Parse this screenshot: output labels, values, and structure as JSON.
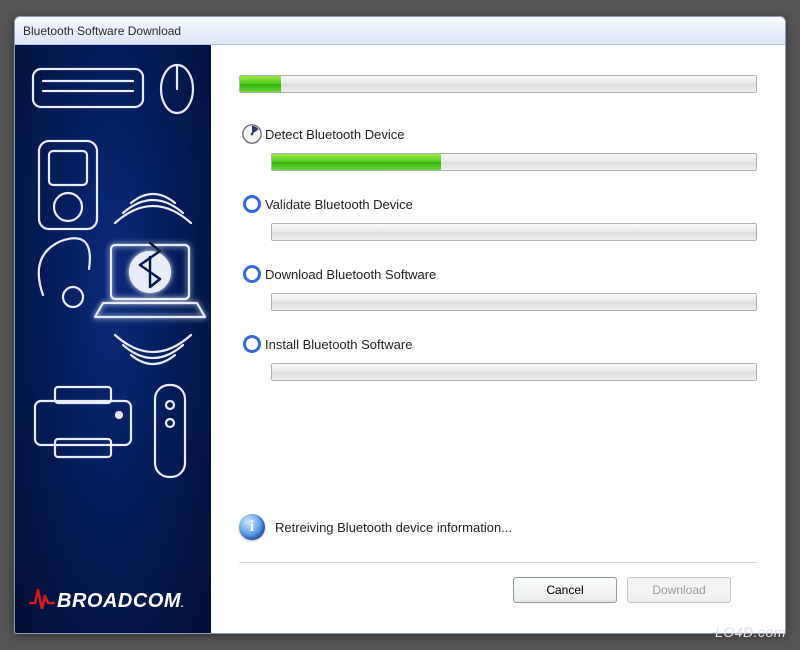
{
  "window": {
    "title": "Bluetooth Software Download"
  },
  "overall_progress_percent": 8,
  "steps": [
    {
      "label": "Detect Bluetooth Device",
      "status": "active",
      "progress": 35
    },
    {
      "label": "Validate Bluetooth Device",
      "status": "pending",
      "progress": 0
    },
    {
      "label": "Download Bluetooth Software",
      "status": "pending",
      "progress": 0
    },
    {
      "label": "Install Bluetooth Software",
      "status": "pending",
      "progress": 0
    }
  ],
  "status_message": "Retreiving Bluetooth device information...",
  "buttons": {
    "cancel": {
      "label": "Cancel",
      "enabled": true
    },
    "download": {
      "label": "Download",
      "enabled": false
    }
  },
  "brand": {
    "name": "BROADCOM",
    "suffix": "."
  },
  "sidebar_icons": [
    "keyboard-icon",
    "mouse-icon",
    "mp3-player-icon",
    "wireless-waves-icon",
    "headset-icon",
    "bluetooth-laptop-icon",
    "printer-icon",
    "remote-icon"
  ],
  "watermark": "LO4D.com",
  "colors": {
    "accent_green": "#4fc71d",
    "accent_blue": "#2f6bd8",
    "brand_red": "#d31b1b"
  }
}
